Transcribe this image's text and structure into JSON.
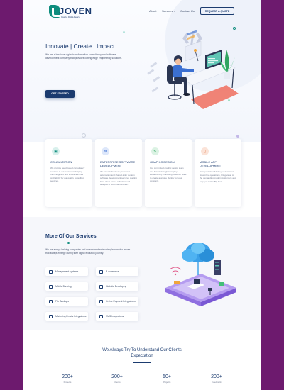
{
  "brand": {
    "name": "JOVEN",
    "tagline": "Creative Digital Agency"
  },
  "nav": {
    "about": "About",
    "services": "Services ⌄",
    "contact": "Contact Us",
    "cta": "REQUEST A QUOTE"
  },
  "hero": {
    "title": "Innovate | Create | Impact",
    "text": "We are a boutique digital transformation consultancy and software development company that provides cutting edge engineering solutions.",
    "button": "GET STARTED"
  },
  "cards": [
    {
      "title": "CONSULTATION",
      "text": "We provide need based consultancy services to our customers helping them augment and accelerate their profitability by our quality consulting services.",
      "icon": "briefcase-icon",
      "color": "#0f8d7e"
    },
    {
      "title": "ENTERPRISE SOFTWARE DEVELOPMENT",
      "text": "We provide business processes automation and shared-tailor custom software development services starting from client-based collection and analysis to post maintenance.",
      "icon": "gear-icon",
      "color": "#3b6fd1"
    },
    {
      "title": "GRAPHIC DESIGN",
      "text": "Our committed graphic design team and brand strategists employ extraordinary marketing research skills to create a unique identity for your company.",
      "icon": "brush-icon",
      "color": "#2fa560"
    },
    {
      "title": "MOBILE APP DEVELOPMENT",
      "text": "Using mobile will help your business streamline operations, bring value to the demanding modern customers and help you tackle Big Data.",
      "icon": "phone-icon",
      "color": "#e0703b"
    }
  ],
  "services": {
    "title": "More Of Our Services",
    "text": "We are always helping companies and enterprise clients untangle complex issues that always emerge during their digital evolution journey.",
    "items": [
      "Management systems",
      "E-commerce",
      "Mobile Banking",
      "Website Developing",
      "File Backups",
      "Online Payment Integrations",
      "Marketing Emails Integrations",
      "SMS Integrations"
    ]
  },
  "bottom": {
    "title_line1": "We Always Try To Understand Our Clients",
    "title_line2": "Expectation",
    "stats": [
      {
        "value": "200+",
        "label": "Projects"
      },
      {
        "value": "200+",
        "label": "Clients"
      },
      {
        "value": "50+",
        "label": "Projects"
      },
      {
        "value": "200+",
        "label": "Feedback"
      }
    ]
  },
  "colors": {
    "primary": "#1b3b6f",
    "accent": "#0f8d7e",
    "background": "#6d1a6e"
  }
}
